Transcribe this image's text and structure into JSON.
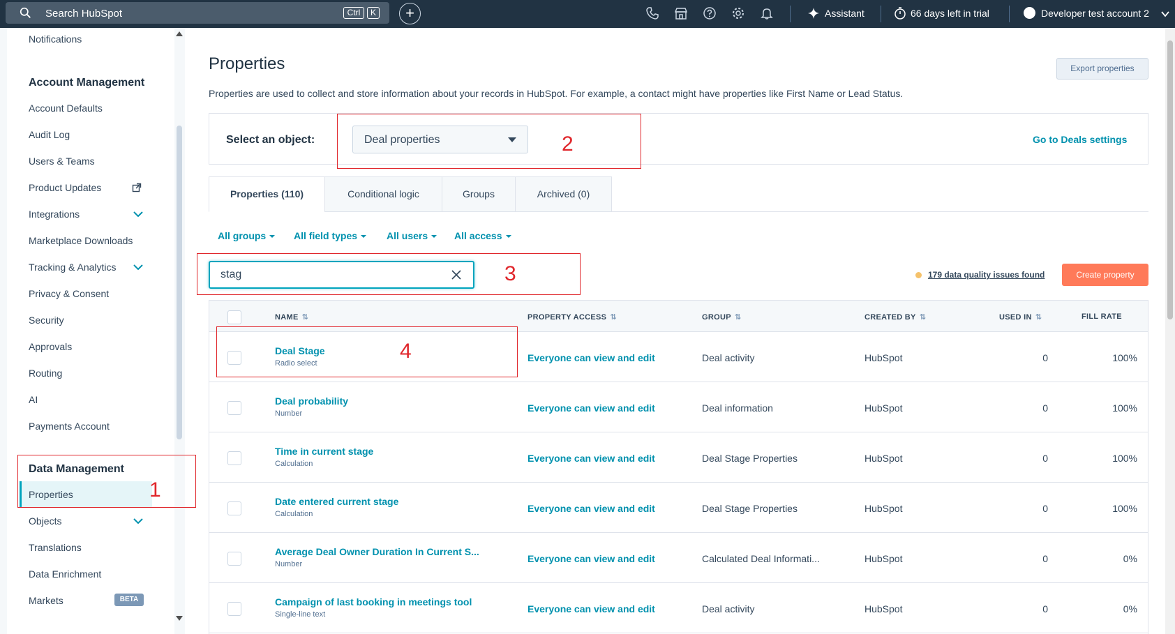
{
  "topbar": {
    "search_label": "Search HubSpot",
    "kbd_ctrl": "Ctrl",
    "kbd_k": "K",
    "plus": "+",
    "assistant": "Assistant",
    "trial": "66 days left in trial",
    "account": "Developer test account 2"
  },
  "sidebar": {
    "notifications": "Notifications",
    "account_management": "Account Management",
    "account_items": [
      "Account Defaults",
      "Audit Log",
      "Users & Teams",
      "Product Updates",
      "Integrations",
      "Marketplace Downloads",
      "Tracking & Analytics",
      "Privacy & Consent",
      "Security",
      "Approvals",
      "Routing",
      "AI",
      "Payments Account"
    ],
    "data_management": "Data Management",
    "data_items": [
      "Properties",
      "Objects",
      "Translations",
      "Data Enrichment",
      "Markets"
    ],
    "beta": "BETA"
  },
  "main": {
    "title": "Properties",
    "export_button": "Export properties",
    "description": "Properties are used to collect and store information about your records in HubSpot. For example, a contact might have properties like First Name or Lead Status.",
    "select_label": "Select an object:",
    "selected_object": "Deal properties",
    "deals_settings": "Go to Deals settings",
    "tabs": [
      "Properties (110)",
      "Conditional logic",
      "Groups",
      "Archived (0)"
    ],
    "filters": [
      "All groups",
      "All field types",
      "All users",
      "All access"
    ],
    "search_value": "stag",
    "data_quality": "179 data quality issues found",
    "create_button": "Create property"
  },
  "table": {
    "headers": [
      "NAME",
      "PROPERTY ACCESS",
      "GROUP",
      "CREATED BY",
      "USED IN",
      "FILL RATE"
    ],
    "sort_glyph": "⇅",
    "rows": [
      {
        "name": "Deal Stage",
        "type": "Radio select",
        "access": "Everyone can view and edit",
        "group": "Deal activity",
        "by": "HubSpot",
        "used": "0",
        "fill": "100%"
      },
      {
        "name": "Deal probability",
        "type": "Number",
        "access": "Everyone can view and edit",
        "group": "Deal information",
        "by": "HubSpot",
        "used": "0",
        "fill": "100%"
      },
      {
        "name": "Time in current stage",
        "type": "Calculation",
        "access": "Everyone can view and edit",
        "group": "Deal Stage Properties",
        "by": "HubSpot",
        "used": "0",
        "fill": "100%"
      },
      {
        "name": "Date entered current stage",
        "type": "Calculation",
        "access": "Everyone can view and edit",
        "group": "Deal Stage Properties",
        "by": "HubSpot",
        "used": "0",
        "fill": "100%"
      },
      {
        "name": "Average Deal Owner Duration In Current S...",
        "type": "Number",
        "access": "Everyone can view and edit",
        "group": "Calculated Deal Informati...",
        "by": "HubSpot",
        "used": "0",
        "fill": "0%"
      },
      {
        "name": "Campaign of last booking in meetings tool",
        "type": "Single-line text",
        "access": "Everyone can view and edit",
        "group": "Deal activity",
        "by": "HubSpot",
        "used": "0",
        "fill": "0%"
      }
    ]
  },
  "annotations": [
    "1",
    "2",
    "3",
    "4"
  ],
  "colors": {
    "accent": "#0091ae",
    "topbar": "#213343",
    "create": "#ff7a59",
    "annotation": "#e0262b"
  }
}
